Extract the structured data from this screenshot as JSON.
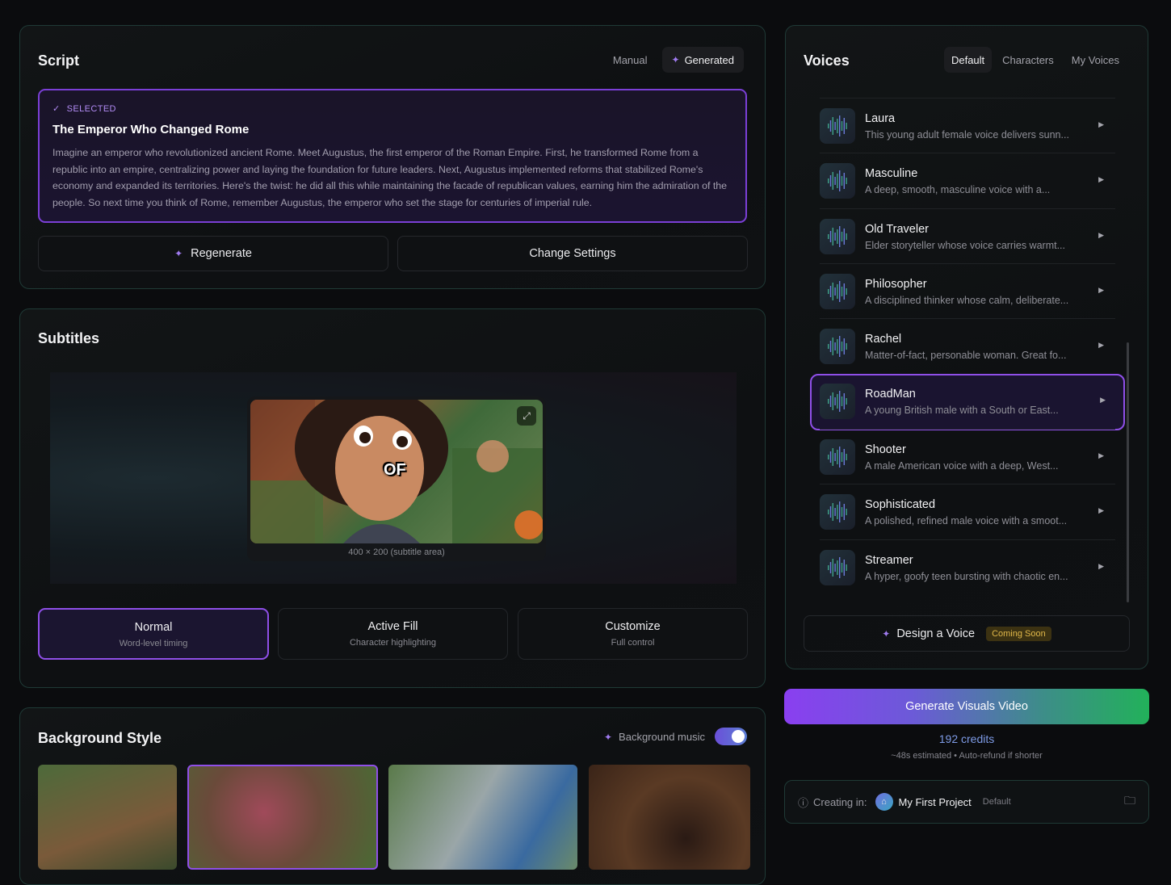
{
  "script": {
    "title": "Script",
    "tabs": [
      {
        "label": "Manual"
      },
      {
        "label": "Generated"
      }
    ],
    "selected_badge": "SELECTED",
    "selected_title": "The Emperor Who Changed Rome",
    "selected_body": "Imagine an emperor who revolutionized ancient Rome. Meet Augustus, the first emperor of the Roman Empire. First, he transformed Rome from a republic into an empire, centralizing power and laying the foundation for future leaders. Next, Augustus implemented reforms that stabilized Rome's economy and expanded its territories. Here's the twist: he did all this while maintaining the facade of republican values, earning him the admiration of the people. So next time you think of Rome, remember Augustus, the emperor who set the stage for centuries of imperial rule.",
    "regenerate_label": "Regenerate",
    "change_settings_label": "Change Settings"
  },
  "subtitles": {
    "title": "Subtitles",
    "preview_word": "OF",
    "preview_caption": "400 × 200 (subtitle area)",
    "options": [
      {
        "title": "Normal",
        "subtitle": "Word-level timing",
        "selected": true
      },
      {
        "title": "Active Fill",
        "subtitle": "Character highlighting",
        "selected": false
      },
      {
        "title": "Customize",
        "subtitle": "Full control",
        "selected": false
      }
    ]
  },
  "background": {
    "title": "Background Style",
    "music_label": "Background music",
    "music_on": true
  },
  "voices": {
    "title": "Voices",
    "tabs": [
      {
        "label": "Default"
      },
      {
        "label": "Characters"
      },
      {
        "label": "My Voices"
      }
    ],
    "items": [
      {
        "name": "Laura",
        "desc": "This young adult female voice delivers sunn..."
      },
      {
        "name": "Masculine",
        "desc": "A deep, smooth, masculine voice with a..."
      },
      {
        "name": "Old Traveler",
        "desc": "Elder storyteller whose voice carries warmt..."
      },
      {
        "name": "Philosopher",
        "desc": "A disciplined thinker whose calm, deliberate..."
      },
      {
        "name": "Rachel",
        "desc": "Matter-of-fact, personable woman. Great fo..."
      },
      {
        "name": "RoadMan",
        "desc": "A young British male with a South or East..."
      },
      {
        "name": "Shooter",
        "desc": "A male American voice with a deep, West..."
      },
      {
        "name": "Sophisticated",
        "desc": "A polished, refined male voice with a smoot..."
      },
      {
        "name": "Streamer",
        "desc": "A hyper, goofy teen bursting with chaotic en..."
      }
    ],
    "design_label": "Design a Voice",
    "coming_soon": "Coming Soon"
  },
  "generate": {
    "label": "Generate Visuals Video",
    "credits": "192 credits",
    "estimate": "~48s estimated • Auto-refund if shorter"
  },
  "creating": {
    "label": "Creating in:",
    "project": "My First Project",
    "tag": "Default"
  },
  "colors": {
    "accent": "#8f4fe8",
    "border": "#1f3a36",
    "green": "#22b15a"
  }
}
